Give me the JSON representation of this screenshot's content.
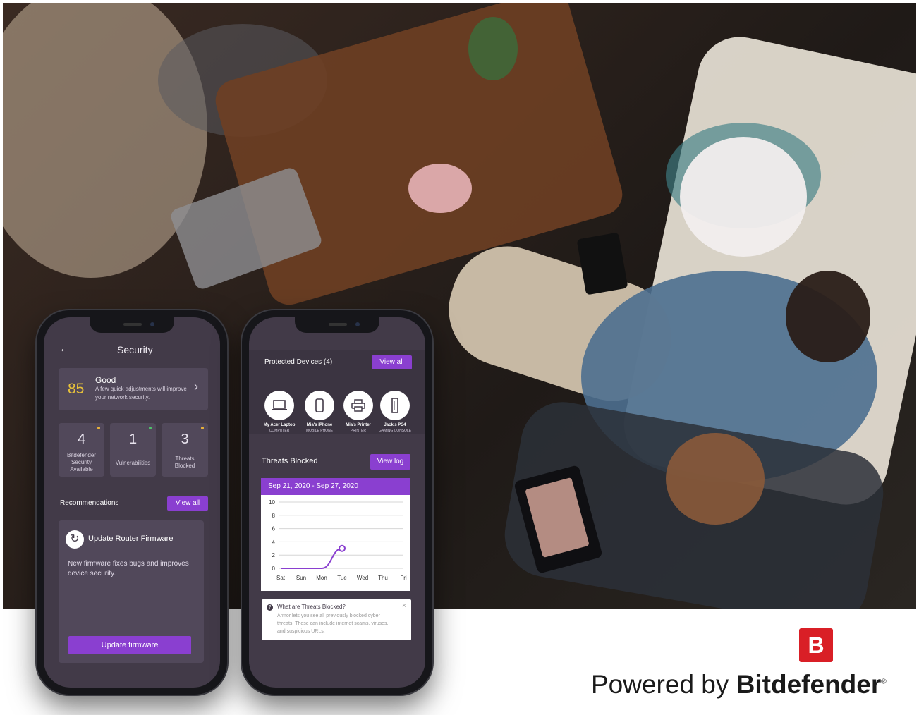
{
  "left_phone": {
    "title": "Security",
    "score": "85",
    "status": "Good",
    "status_desc_1": "A few quick adjustments will improve",
    "status_desc_2": "your network security.",
    "stats": [
      {
        "value": "4",
        "label_lines": [
          "Bitdefender",
          "Security",
          "Available"
        ],
        "dot_color": "#e8b23a"
      },
      {
        "value": "1",
        "label_lines": [
          "Vulnerabilities"
        ],
        "dot_color": "#4fc36b"
      },
      {
        "value": "3",
        "label_lines": [
          "Threats",
          "Blocked"
        ],
        "dot_color": "#e8b23a"
      }
    ],
    "recommendations_label": "Recommendations",
    "view_all_label": "View all",
    "rec_title": "Update Router Firmware",
    "rec_desc_1": "New firmware fixes bugs and improves",
    "rec_desc_2": "device security.",
    "update_button": "Update firmware"
  },
  "right_phone": {
    "devices_label": "Protected Devices (4)",
    "view_all_label": "View all",
    "devices": [
      {
        "name": "My Acer Laptop",
        "type": "COMPUTER",
        "icon": "laptop-icon"
      },
      {
        "name": "Mia's iPhone",
        "type": "MOBILE PHONE",
        "icon": "phone-icon"
      },
      {
        "name": "Mia's Printer",
        "type": "PRINTER",
        "icon": "printer-icon"
      },
      {
        "name": "Jack's PS4",
        "type": "GAMING CONSOLE",
        "icon": "console-icon"
      }
    ],
    "threats_label": "Threats Blocked",
    "view_log_label": "View log",
    "date_range": "Sep 21, 2020 - Sep 27, 2020",
    "info_title": "What are Threats Blocked?",
    "info_close": "×",
    "info_lines": [
      "Armor lets you see all previously blocked cyber",
      "threats. These can include internet scams, viruses,",
      "and suspicious URLs."
    ]
  },
  "chart_data": {
    "type": "line",
    "categories": [
      "Sat",
      "Sun",
      "Mon",
      "Tue",
      "Wed",
      "Thu",
      "Fri"
    ],
    "values": [
      0,
      0,
      0,
      3,
      null,
      null,
      null
    ],
    "ylim": [
      0,
      10
    ],
    "yticks": [
      0,
      2,
      4,
      6,
      8,
      10
    ],
    "grid": true,
    "color": "#8a3fd0"
  },
  "brand": {
    "logo_letter": "B",
    "prefix": "Powered by",
    "name": "Bitdefender",
    "reg": "®"
  },
  "colors": {
    "accent": "#8a3fd0",
    "brand_red": "#d91f26",
    "score": "#e8c23a"
  }
}
